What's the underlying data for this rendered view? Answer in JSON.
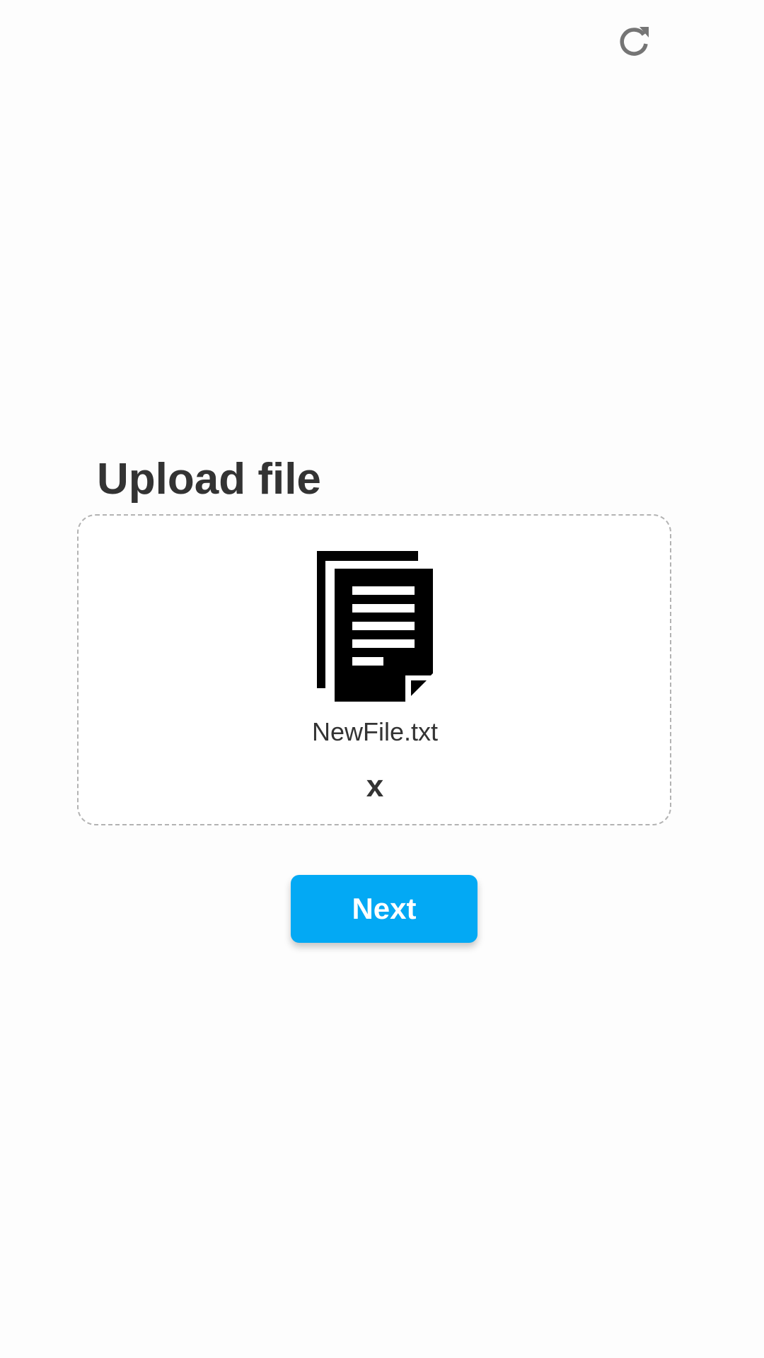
{
  "header": {
    "refresh_icon": "refresh-icon",
    "refresh_color": "#757575"
  },
  "upload": {
    "title": "Upload file",
    "file_icon": "document-icon",
    "file_name": "NewFile.txt",
    "remove_label": "x"
  },
  "actions": {
    "next_label": "Next",
    "next_color": "#03a9f4"
  }
}
